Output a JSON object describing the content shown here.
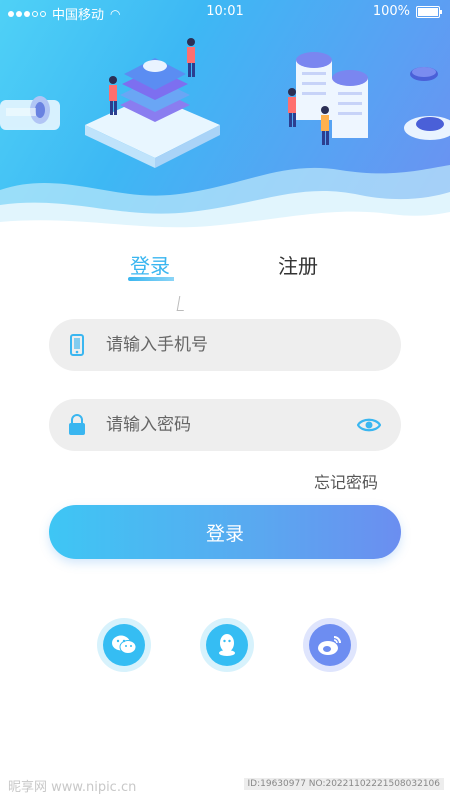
{
  "status_bar": {
    "carrier": "中国移动",
    "time": "10:01",
    "battery": "100%"
  },
  "tabs": {
    "login": "登录",
    "register": "注册",
    "active": "login"
  },
  "phone_field": {
    "placeholder": "请输入手机号",
    "value": "",
    "icon": "phone-icon"
  },
  "password_field": {
    "placeholder": "请输入密码",
    "value": "",
    "icon": "lock-icon",
    "toggle_icon": "eye-icon"
  },
  "forgot_password": "忘记密码",
  "login_button": "登录",
  "social_login": [
    {
      "name": "wechat",
      "icon": "wechat-icon"
    },
    {
      "name": "qq",
      "icon": "qq-icon"
    },
    {
      "name": "weibo",
      "icon": "weibo-icon"
    }
  ],
  "watermark": {
    "site": "昵享网 www.nipic.cn",
    "id": "ID:19630977 NO:20221102221508032106"
  },
  "colors": {
    "accent": "#3ab6f0",
    "gradient_start": "#3ec6f4",
    "gradient_end": "#6b8ef0",
    "input_bg": "#eeeeee"
  }
}
